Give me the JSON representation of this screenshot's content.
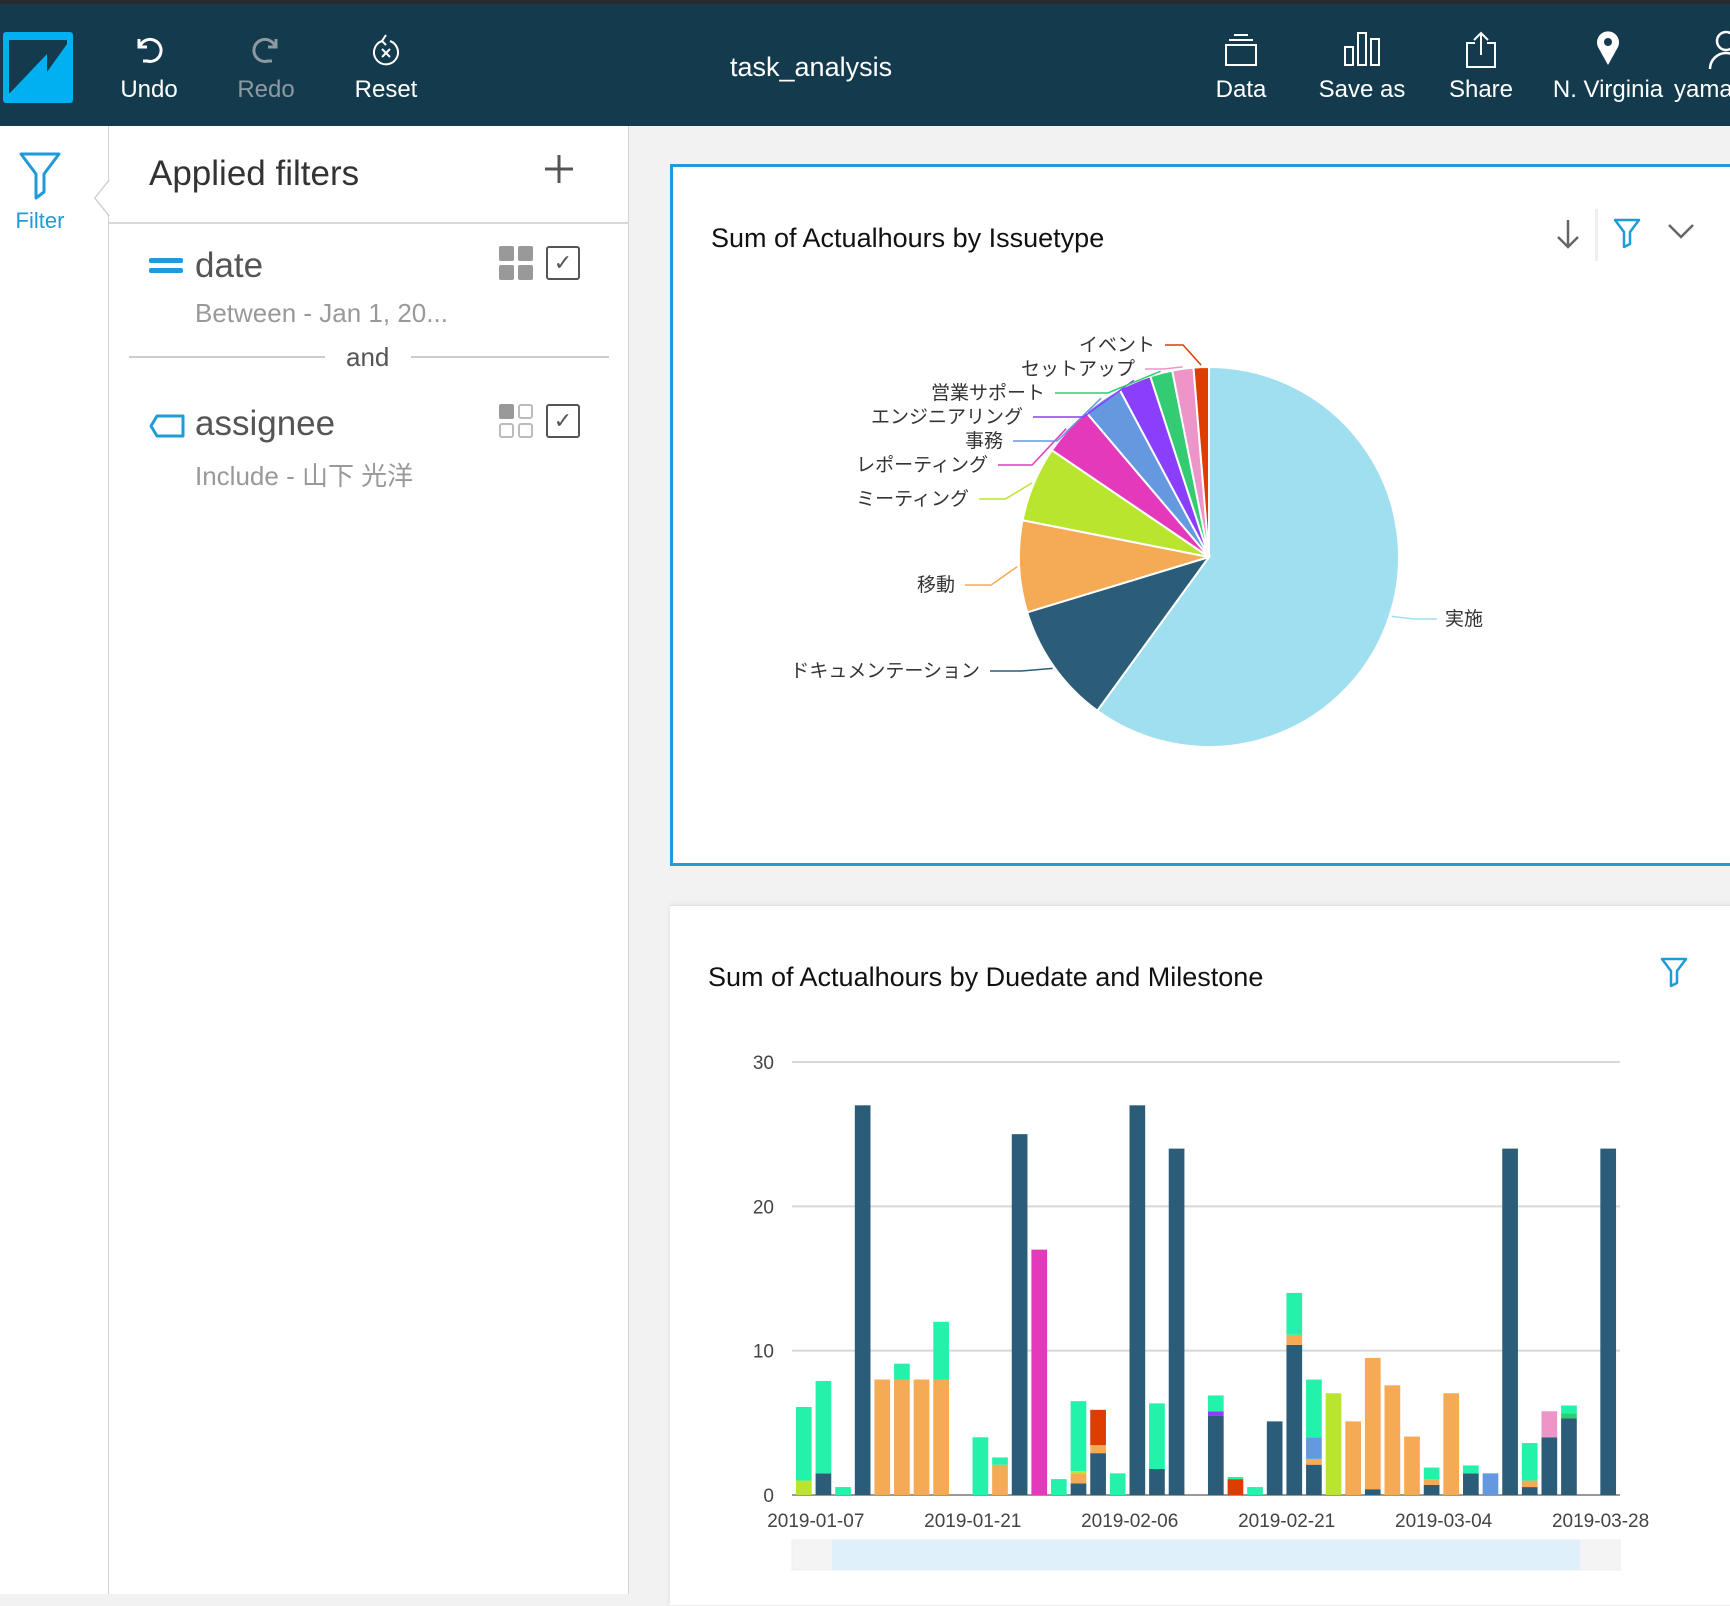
{
  "app": {
    "document_title": "task_analysis",
    "logo": "quicksight-logo",
    "toolbar_left": [
      {
        "label": "Undo",
        "icon": "undo-icon",
        "enabled": true
      },
      {
        "label": "Redo",
        "icon": "redo-icon",
        "enabled": false
      },
      {
        "label": "Reset",
        "icon": "reset-icon",
        "enabled": true
      }
    ],
    "toolbar_right": [
      {
        "label": "Data",
        "icon": "data-icon"
      },
      {
        "label": "Save as",
        "icon": "save-as-icon"
      },
      {
        "label": "Share",
        "icon": "share-icon"
      },
      {
        "label": "N. Virginia",
        "icon": "location-pin-icon"
      },
      {
        "label": "yaman",
        "icon": "user-icon"
      }
    ]
  },
  "rail": {
    "filter_label": "Filter",
    "icon": "filter-icon"
  },
  "filters_panel": {
    "title": "Applied filters",
    "add_icon": "plus-icon",
    "connector": "and",
    "filters": [
      {
        "name": "date",
        "description": "Between - Jan 1, 20...",
        "type_icon": "equals-icon",
        "applies_to": "all-visuals-icon",
        "enabled": true
      },
      {
        "name": "assignee",
        "description": "Include - 山下 光洋",
        "type_icon": "tag-icon",
        "applies_to": "single-visual-icon",
        "enabled": true
      }
    ]
  },
  "visuals": [
    {
      "title": "Sum of Actualhours by Issuetype",
      "icons": [
        "download-icon",
        "filter-icon",
        "chevron-down-icon"
      ]
    },
    {
      "title": "Sum of Actualhours by Duedate and Milestone",
      "icons": [
        "filter-icon"
      ]
    }
  ],
  "chart_data": [
    {
      "type": "pie",
      "title": "Sum of Actualhours by Issuetype",
      "slices": [
        {
          "label": "実施",
          "share": 0.6,
          "color": "#9fdfef"
        },
        {
          "label": "ドキュメンテーション",
          "share": 0.103,
          "color": "#2c5d78"
        },
        {
          "label": "移動",
          "share": 0.078,
          "color": "#f5aa55"
        },
        {
          "label": "ミーティング",
          "share": 0.064,
          "color": "#b9e52f"
        },
        {
          "label": "レポーティング",
          "share": 0.043,
          "color": "#e539bc"
        },
        {
          "label": "事務",
          "share": 0.034,
          "color": "#6499e0"
        },
        {
          "label": "エンジニアリング",
          "share": 0.028,
          "color": "#8a3ffc"
        },
        {
          "label": "営業サポート",
          "share": 0.019,
          "color": "#33cc72"
        },
        {
          "label": "セットアップ",
          "share": 0.018,
          "color": "#ed94c9"
        },
        {
          "label": "イベント",
          "share": 0.013,
          "color": "#de3d00"
        }
      ]
    },
    {
      "type": "bar",
      "stacked": true,
      "title": "Sum of Actualhours by Duedate and Milestone",
      "xlabel": "",
      "ylabel": "",
      "ylim": [
        0,
        30
      ],
      "yticks": [
        "0",
        "10",
        "20",
        "30"
      ],
      "xticks": [
        "2019-01-07",
        "2019-01-21",
        "2019-02-06",
        "2019-02-21",
        "2019-03-04",
        "2019-03-28"
      ],
      "grid": true,
      "legend": "none",
      "series_colors": {
        "navy": "#2c5d78",
        "teal": "#24f2aa",
        "orange": "#f5aa55",
        "lime": "#b9e52f",
        "magenta": "#e539bc",
        "red": "#de3d00",
        "purple": "#8a3ffc",
        "blue": "#6499e0",
        "pink": "#ed94c9",
        "green": "#33cc72"
      },
      "bars": [
        [
          [
            "lime",
            1.0
          ],
          [
            "teal",
            5.1
          ]
        ],
        [
          [
            "navy",
            1.5
          ],
          [
            "teal",
            6.4
          ]
        ],
        [
          [
            "teal",
            0.55
          ]
        ],
        [
          [
            "navy",
            27
          ]
        ],
        [
          [
            "orange",
            8
          ]
        ],
        [
          [
            "orange",
            8
          ],
          [
            "teal",
            1.1
          ]
        ],
        [
          [
            "orange",
            8
          ]
        ],
        [
          [
            "orange",
            8
          ],
          [
            "teal",
            4.0
          ]
        ],
        [],
        [
          [
            "teal",
            4.0
          ]
        ],
        [
          [
            "orange",
            2.1
          ],
          [
            "teal",
            0.5
          ]
        ],
        [
          [
            "navy",
            25
          ]
        ],
        [
          [
            "magenta",
            17
          ]
        ],
        [
          [
            "teal",
            1.1
          ]
        ],
        [
          [
            "navy",
            0.8
          ],
          [
            "orange",
            0.7
          ],
          [
            "lime",
            0.15
          ],
          [
            "teal",
            4.85
          ]
        ],
        [
          [
            "navy",
            2.9
          ],
          [
            "orange",
            0.55
          ],
          [
            "red",
            2.45
          ]
        ],
        [
          [
            "teal",
            1.5
          ]
        ],
        [
          [
            "navy",
            27
          ]
        ],
        [
          [
            "navy",
            1.8
          ],
          [
            "teal",
            4.55
          ]
        ],
        [
          [
            "navy",
            24
          ]
        ],
        [],
        [
          [
            "navy",
            5.5
          ],
          [
            "purple",
            0.3
          ],
          [
            "teal",
            1.1
          ]
        ],
        [
          [
            "red",
            1.1
          ],
          [
            "teal",
            0.15
          ]
        ],
        [
          [
            "teal",
            0.55
          ]
        ],
        [
          [
            "navy",
            5.1
          ]
        ],
        [
          [
            "navy",
            10.4
          ],
          [
            "orange",
            0.7
          ],
          [
            "teal",
            2.9
          ]
        ],
        [
          [
            "navy",
            2.1
          ],
          [
            "orange",
            0.4
          ],
          [
            "blue",
            1.5
          ],
          [
            "teal",
            4.0
          ]
        ],
        [
          [
            "lime",
            7.05
          ]
        ],
        [
          [
            "orange",
            5.1
          ]
        ],
        [
          [
            "navy",
            0.4
          ],
          [
            "orange",
            9.1
          ]
        ],
        [
          [
            "orange",
            7.6
          ]
        ],
        [
          [
            "orange",
            4.05
          ]
        ],
        [
          [
            "navy",
            0.7
          ],
          [
            "orange",
            0.4
          ],
          [
            "teal",
            0.8
          ]
        ],
        [
          [
            "orange",
            7.05
          ]
        ],
        [
          [
            "navy",
            1.5
          ],
          [
            "teal",
            0.55
          ]
        ],
        [
          [
            "blue",
            1.5
          ]
        ],
        [
          [
            "navy",
            24
          ]
        ],
        [
          [
            "navy",
            0.55
          ],
          [
            "orange",
            0.45
          ],
          [
            "teal",
            2.6
          ]
        ],
        [
          [
            "navy",
            4.0
          ],
          [
            "pink",
            1.8
          ]
        ],
        [
          [
            "navy",
            5.3
          ],
          [
            "green",
            0.35
          ],
          [
            "teal",
            0.55
          ]
        ],
        [],
        [
          [
            "navy",
            24
          ]
        ]
      ]
    }
  ]
}
